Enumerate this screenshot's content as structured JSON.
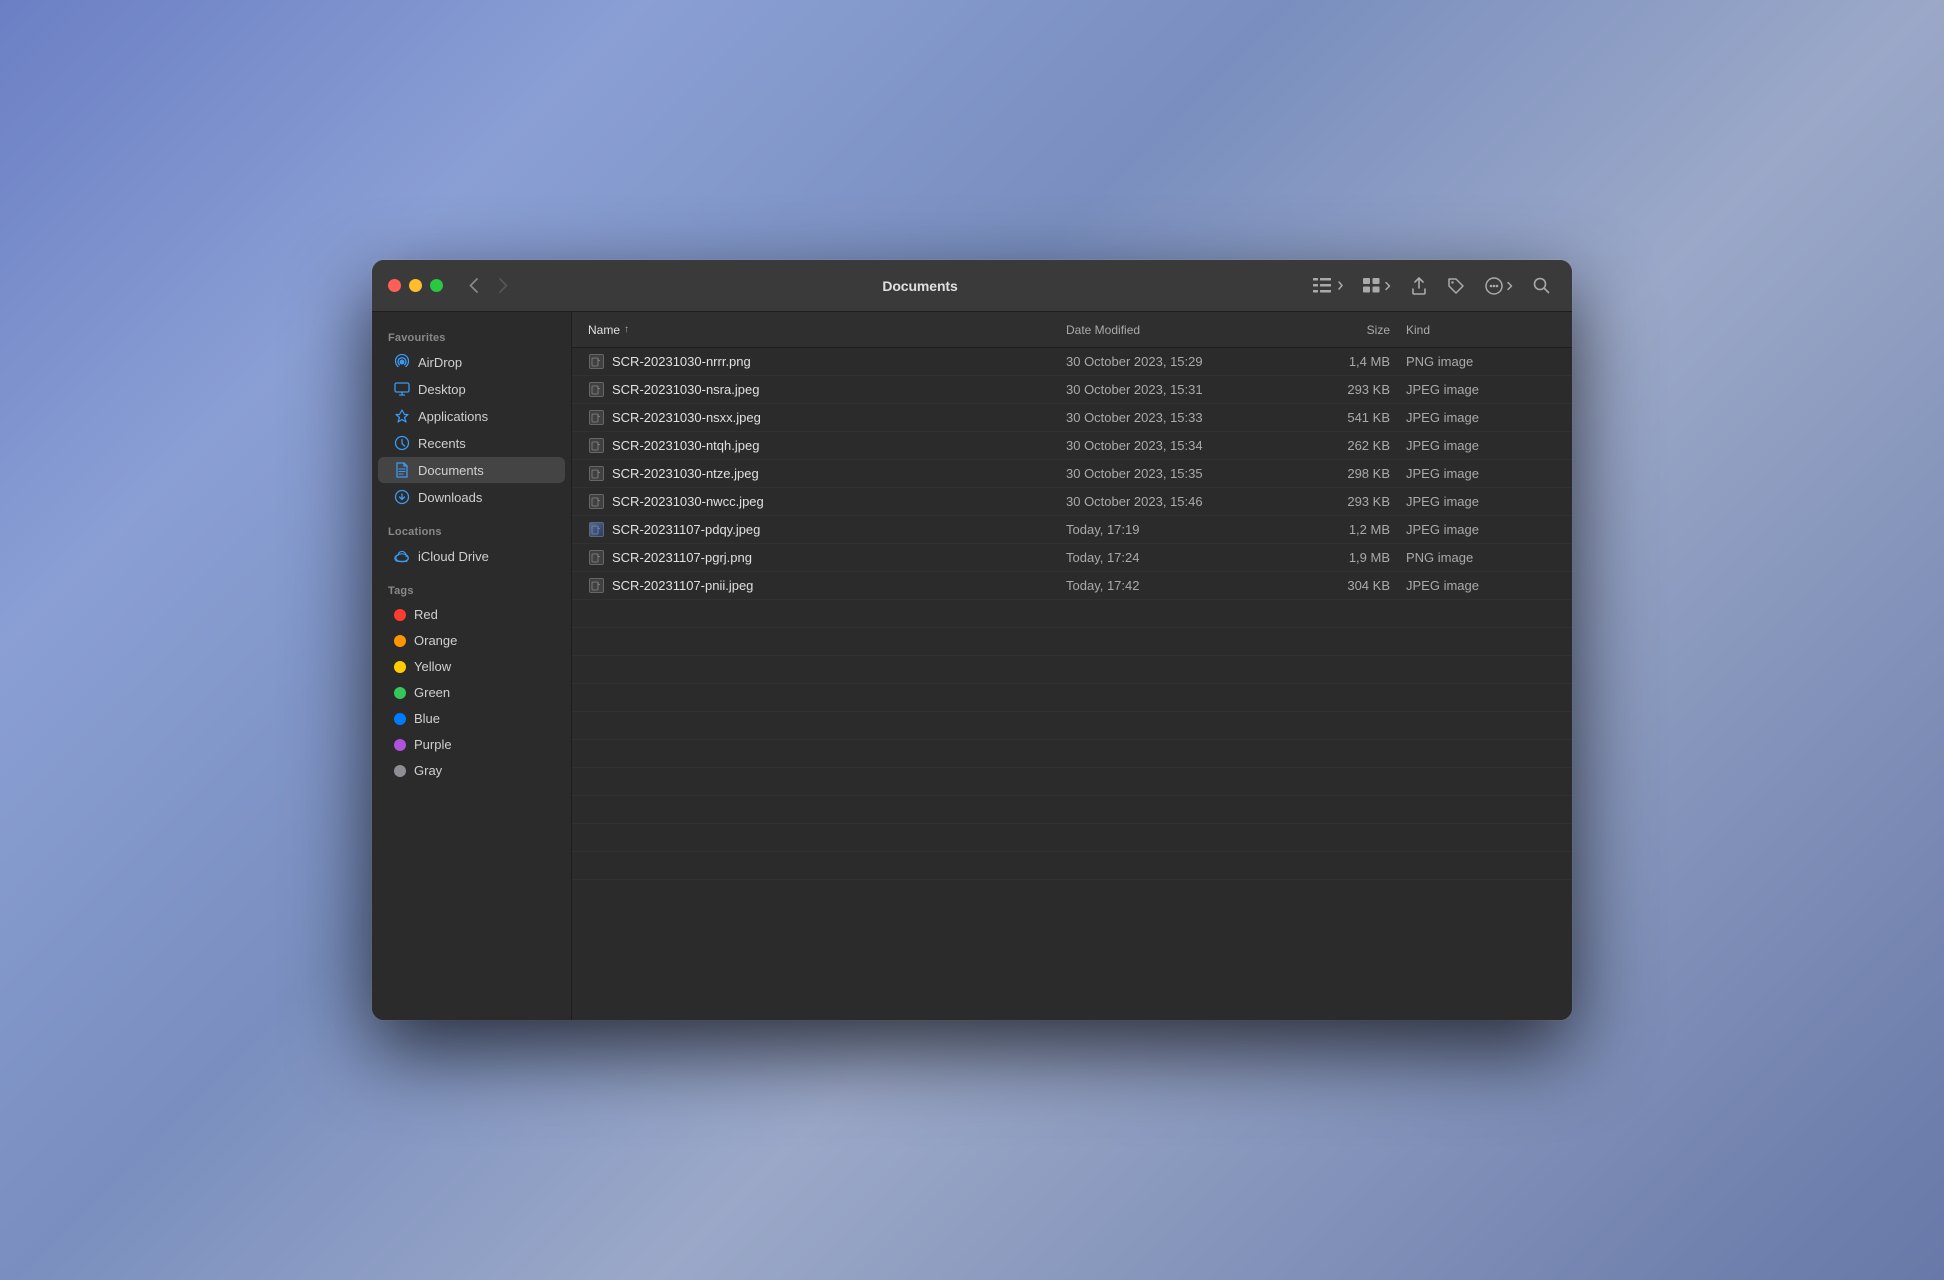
{
  "window": {
    "title": "Documents"
  },
  "toolbar": {
    "back_label": "‹",
    "forward_label": "›"
  },
  "sidebar": {
    "sections": [
      {
        "label": "Favourites",
        "items": [
          {
            "id": "airdrop",
            "name": "AirDrop",
            "icon": "airdrop"
          },
          {
            "id": "desktop",
            "name": "Desktop",
            "icon": "desktop"
          },
          {
            "id": "applications",
            "name": "Applications",
            "icon": "applications"
          },
          {
            "id": "recents",
            "name": "Recents",
            "icon": "recents"
          },
          {
            "id": "documents",
            "name": "Documents",
            "icon": "documents",
            "active": true
          },
          {
            "id": "downloads",
            "name": "Downloads",
            "icon": "downloads"
          }
        ]
      },
      {
        "label": "Locations",
        "items": [
          {
            "id": "icloud",
            "name": "iCloud Drive",
            "icon": "icloud"
          }
        ]
      },
      {
        "label": "Tags",
        "items": [
          {
            "id": "red",
            "name": "Red",
            "color": "#ff3b30"
          },
          {
            "id": "orange",
            "name": "Orange",
            "color": "#ff9500"
          },
          {
            "id": "yellow",
            "name": "Yellow",
            "color": "#ffcc00"
          },
          {
            "id": "green",
            "name": "Green",
            "color": "#34c759"
          },
          {
            "id": "blue",
            "name": "Blue",
            "color": "#007aff"
          },
          {
            "id": "purple",
            "name": "Purple",
            "color": "#af52de"
          },
          {
            "id": "gray",
            "name": "Gray",
            "color": "#8e8e93"
          }
        ]
      }
    ]
  },
  "columns": {
    "name": "Name",
    "date_modified": "Date Modified",
    "size": "Size",
    "kind": "Kind"
  },
  "files": [
    {
      "name": "SCR-20231030-nrrr.png",
      "date": "30 October 2023, 15:29",
      "size": "1,4 MB",
      "kind": "PNG image",
      "preview": false
    },
    {
      "name": "SCR-20231030-nsra.jpeg",
      "date": "30 October 2023, 15:31",
      "size": "293 KB",
      "kind": "JPEG image",
      "preview": false
    },
    {
      "name": "SCR-20231030-nsxx.jpeg",
      "date": "30 October 2023, 15:33",
      "size": "541 KB",
      "kind": "JPEG image",
      "preview": false
    },
    {
      "name": "SCR-20231030-ntqh.jpeg",
      "date": "30 October 2023, 15:34",
      "size": "262 KB",
      "kind": "JPEG image",
      "preview": false
    },
    {
      "name": "SCR-20231030-ntze.jpeg",
      "date": "30 October 2023, 15:35",
      "size": "298 KB",
      "kind": "JPEG image",
      "preview": false
    },
    {
      "name": "SCR-20231030-nwcc.jpeg",
      "date": "30 October 2023, 15:46",
      "size": "293 KB",
      "kind": "JPEG image",
      "preview": false
    },
    {
      "name": "SCR-20231107-pdqy.jpeg",
      "date": "Today, 17:19",
      "size": "1,2 MB",
      "kind": "JPEG image",
      "preview": true
    },
    {
      "name": "SCR-20231107-pgrj.png",
      "date": "Today, 17:24",
      "size": "1,9 MB",
      "kind": "PNG image",
      "preview": false
    },
    {
      "name": "SCR-20231107-pnii.jpeg",
      "date": "Today, 17:42",
      "size": "304 KB",
      "kind": "JPEG image",
      "preview": false
    }
  ],
  "empty_rows": 10
}
